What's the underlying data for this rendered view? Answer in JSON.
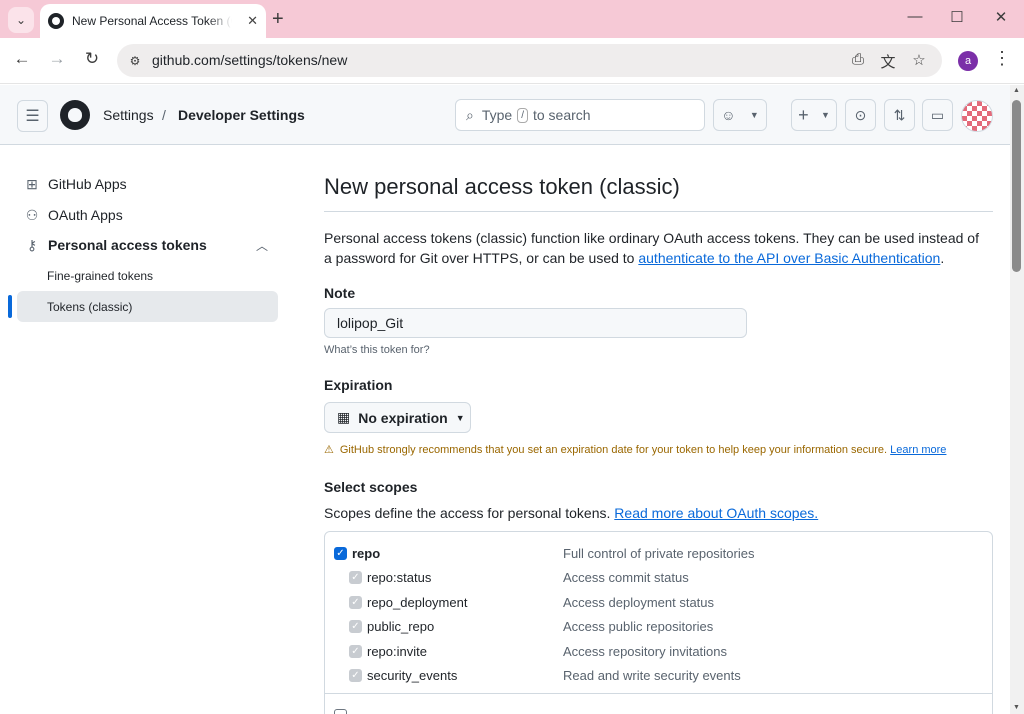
{
  "browser": {
    "tab_title": "New Personal Access Token (Classic)",
    "tab_close": "✕",
    "new_tab": "+",
    "url": "github.com/settings/tokens/new",
    "profile_initial": "a",
    "window_controls": {
      "minimize": "—",
      "maximize": "☐",
      "close": "✕"
    }
  },
  "header": {
    "crumb_settings": "Settings",
    "crumb_separator": "/",
    "crumb_developer": "Developer Settings",
    "search_prefix": "Type",
    "search_key": "/",
    "search_suffix": "to search",
    "plus_label": "+"
  },
  "sidebar": {
    "items": [
      {
        "label": "GitHub Apps",
        "icon": "apps-grid-icon"
      },
      {
        "label": "OAuth Apps",
        "icon": "person-icon"
      },
      {
        "label": "Personal access tokens",
        "icon": "key-icon"
      }
    ],
    "sub_items": [
      {
        "label": "Fine-grained tokens"
      },
      {
        "label": "Tokens (classic)"
      }
    ]
  },
  "main": {
    "title": "New personal access token (classic)",
    "intro_text": "Personal access tokens (classic) function like ordinary OAuth access tokens. They can be used instead of a password for Git over HTTPS, or can be used to",
    "intro_link": "authenticate to the API over Basic Authentication",
    "intro_end": ".",
    "note_label": "Note",
    "note_value": "lolipop_Git",
    "note_hint": "What’s this token for?",
    "expiration_label": "Expiration",
    "expiration_value": "No expiration",
    "warning_text": "GitHub strongly recommends that you set an expiration date for your token to help keep your information secure.",
    "warning_link": "Learn more",
    "scopes_label": "Select scopes",
    "scopes_desc": "Scopes define the access for personal tokens.",
    "scopes_link": "Read more about OAuth scopes.",
    "scopes": [
      {
        "name": "repo",
        "desc": "Full control of private repositories",
        "checked": true,
        "level": "main"
      },
      {
        "name": "repo:status",
        "desc": "Access commit status",
        "checked": true,
        "level": "sub"
      },
      {
        "name": "repo_deployment",
        "desc": "Access deployment status",
        "checked": true,
        "level": "sub"
      },
      {
        "name": "public_repo",
        "desc": "Access public repositories",
        "checked": true,
        "level": "sub"
      },
      {
        "name": "repo:invite",
        "desc": "Access repository invitations",
        "checked": true,
        "level": "sub"
      },
      {
        "name": "security_events",
        "desc": "Read and write security events",
        "checked": true,
        "level": "sub"
      }
    ]
  },
  "colors": {
    "link": "#0969da",
    "warning": "#9a6700",
    "tab_strip": "#f6c9d6",
    "checkbox": "#0969da"
  }
}
